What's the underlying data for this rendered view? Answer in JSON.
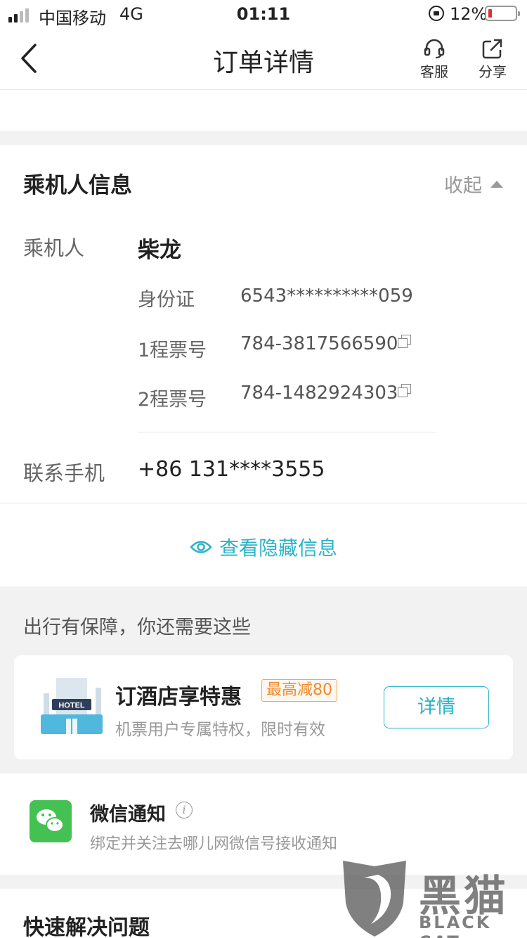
{
  "status_bar": {
    "carrier": "中国移动",
    "network": "4G",
    "time": "01:11",
    "battery": "12%"
  },
  "nav": {
    "title": "订单详情",
    "service_label": "客服",
    "share_label": "分享"
  },
  "passenger_section": {
    "title": "乘机人信息",
    "collapse_label": "收起",
    "passenger_label": "乘机人",
    "passenger_name": "柴龙",
    "id_label": "身份证",
    "id_value": "6543**********059",
    "ticket1_label": "1程票号",
    "ticket1_value": "784-3817566590",
    "ticket2_label": "2程票号",
    "ticket2_value": "784-1482924303",
    "phone_label": "联系手机",
    "phone_value": "+86 131****3555",
    "reveal_label": "查看隐藏信息"
  },
  "guarantee": {
    "title": "出行有保障，你还需要这些",
    "hotel_title": "订酒店享特惠",
    "hotel_badge": "最高减80",
    "hotel_subtitle": "机票用户专属特权，限时有效",
    "hotel_button": "详情",
    "hotel_sign": "HOTEL"
  },
  "wechat": {
    "title": "微信通知",
    "subtitle": "绑定并关注去哪儿网微信号接收通知"
  },
  "quick": {
    "title": "快速解决问题"
  },
  "watermark": {
    "cn": "黑猫",
    "en": "BLACK CAT"
  },
  "colors": {
    "accent": "#2bb3c8",
    "promo": "#f08a2c",
    "wechat": "#45c053",
    "battery_low": "#e03030"
  }
}
